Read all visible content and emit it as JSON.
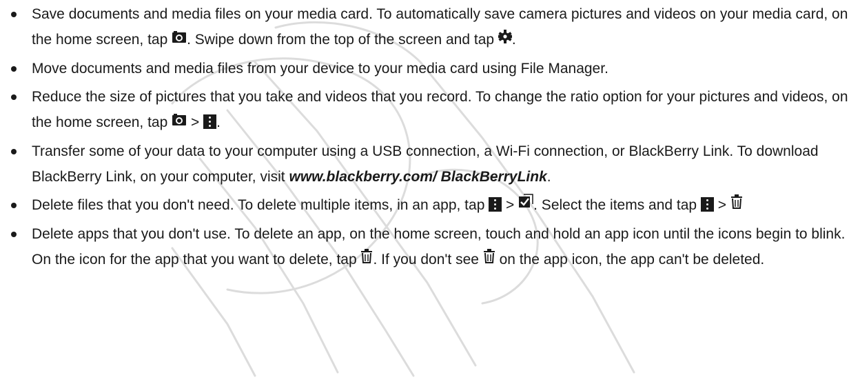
{
  "tips": [
    {
      "t1": "Save documents and media files on your media card. To automatically save camera pictures and videos on your media card, on the home screen, tap ",
      "t2": ". Swipe down from the top of the screen and tap ",
      "t3": "."
    },
    {
      "t1": "Move documents and media files from your device to your media card using File Manager."
    },
    {
      "t1": "Reduce the size of pictures that you take and videos that you record. To change the ratio option for your pictures and videos, on the home screen, tap ",
      "sep": " > ",
      "t2": "."
    },
    {
      "t1": "Transfer some of your data to your computer using a USB connection, a Wi-Fi connection, or BlackBerry Link. To download BlackBerry Link, on your computer, visit ",
      "link": "www.blackberry.com/ BlackBerryLink",
      "t2": "."
    },
    {
      "t1": "Delete files that you don't need. To delete multiple items, in an app, tap ",
      "sep1": " > ",
      "t2": ". Select the items and tap ",
      "sep2": " > "
    },
    {
      "t1": "Delete apps that you don't use. To delete an app, on the home screen, touch and hold an app icon until the icons begin to blink. On the icon for the app that you want to delete, tap ",
      "t2": ". If you don't see ",
      "t3": " on the app icon, the app can't be deleted."
    }
  ],
  "icons": {
    "camera": "camera-icon",
    "settings": "gear-icon",
    "menu": "more-menu-icon",
    "select": "select-items-icon",
    "trash": "trash-icon"
  },
  "colors": {
    "text": "#1a1a1a",
    "watermark": "#d9d9d9"
  }
}
